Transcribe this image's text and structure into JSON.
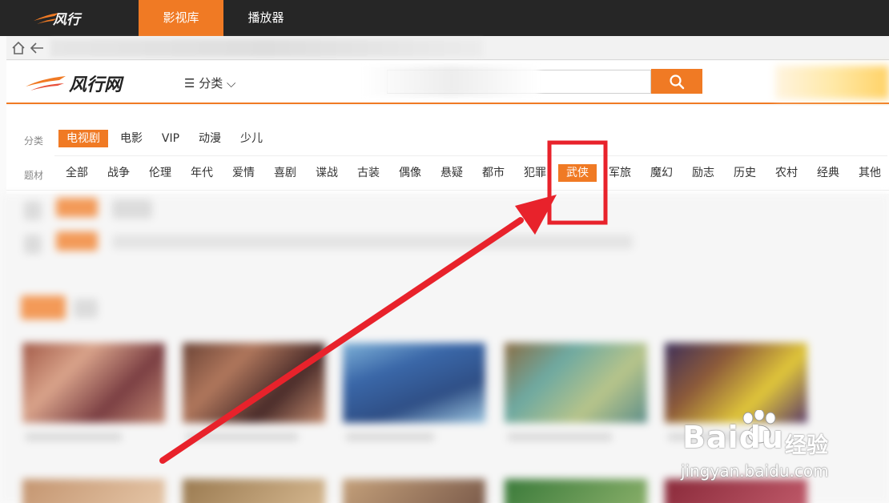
{
  "app": {
    "logo_text": "风行",
    "tabs": [
      {
        "label": "影视库",
        "active": true
      },
      {
        "label": "播放器",
        "active": false
      }
    ]
  },
  "browser": {
    "home_icon": "home-icon",
    "back_icon": "back-arrow-icon"
  },
  "site": {
    "logo_text": "风行网",
    "category_label": "☰ 分类 ⌵",
    "search_placeholder": "",
    "search_icon": "search-icon"
  },
  "filters": {
    "category_row": {
      "label": "分类",
      "items": [
        "电视剧",
        "电影",
        "VIP",
        "动漫",
        "少儿"
      ],
      "active_index": 0
    },
    "theme_row": {
      "label": "题材",
      "items": [
        "全部",
        "战争",
        "伦理",
        "年代",
        "爱情",
        "喜剧",
        "谍战",
        "古装",
        "偶像",
        "悬疑",
        "都市",
        "犯罪",
        "武侠",
        "军旅",
        "魔幻",
        "励志",
        "历史",
        "农村",
        "经典",
        "其他"
      ],
      "active_index": 12
    }
  },
  "annotation": {
    "highlight_color": "#e8222b",
    "arrow_color": "#e8222b",
    "target": "武侠"
  },
  "watermark": {
    "logo": "Baidu",
    "cn": "经验",
    "url": "jingyan.baidu.com"
  },
  "colors": {
    "accent": "#f07a24",
    "appbar": "#262626"
  }
}
